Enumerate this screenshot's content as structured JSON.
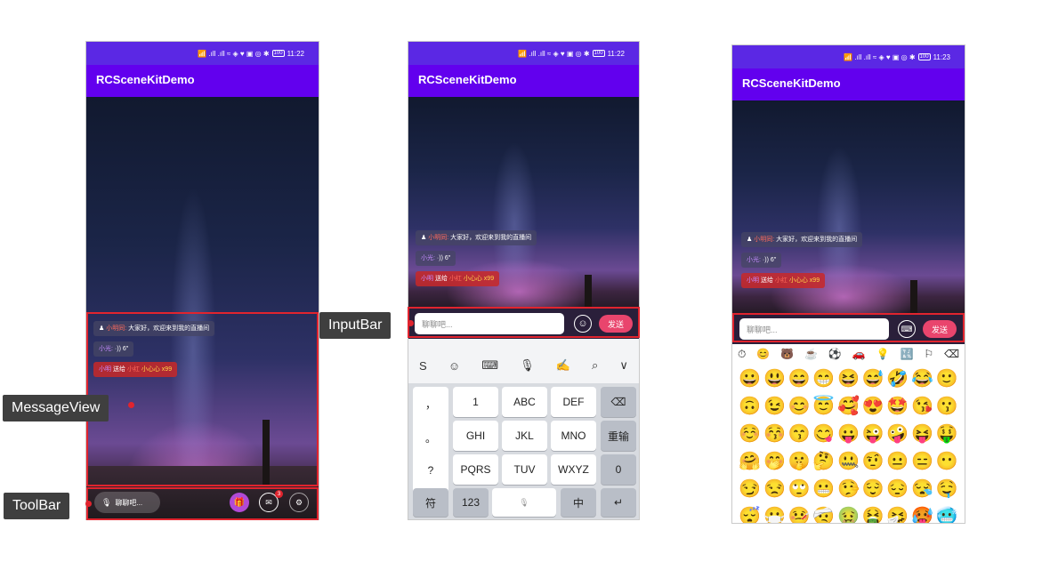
{
  "phones": [
    {
      "status": {
        "icons": "📶 .ıll .ıll ≈ ◈ ♥ ▣ ◎ ✱",
        "battery": "100",
        "time": "11:22"
      },
      "app_title": "RCSceneKitDemo"
    },
    {
      "status": {
        "icons": "📶 .ıll .ıll ≈ ◈ ♥ ▣ ◎ ✱",
        "battery": "100",
        "time": "11:22"
      },
      "app_title": "RCSceneKitDemo"
    },
    {
      "status": {
        "icons": "📶 .ıll .ıll ≈ ◈ ♥ ▣ ◎ ✱",
        "battery": "100",
        "time": "11:23"
      },
      "app_title": "RCSceneKitDemo"
    }
  ],
  "messages": {
    "m1_name": "小明同:",
    "m1_text": "大家好，欢迎来到我的直播间",
    "m2_name": "小光:",
    "m2_text": "·)) 6″",
    "m3_name": "小明",
    "m3_mid": "送给",
    "m3_target": "小红",
    "m3_gift": "小心心 x99"
  },
  "toolbar": {
    "input_placeholder": "聊聊吧...",
    "mic_icon": "🎙",
    "badge_count": "3"
  },
  "inputbar": {
    "placeholder": "聊聊吧...",
    "send_label": "发送",
    "emoji_icon": "☺",
    "keyboard_icon": "⌨"
  },
  "callouts": {
    "messageview": "MessageView",
    "toolbar": "ToolBar",
    "inputbar": "InputBar"
  },
  "keyboard": {
    "toolbar_icons": [
      "S",
      "☺",
      "⌨",
      "🎙",
      "✍",
      "⌕",
      "∨"
    ],
    "left_column": [
      "，",
      "。",
      "?",
      "!"
    ],
    "rows": [
      [
        {
          "top": "",
          "label": "1"
        },
        {
          "top": "2",
          "label": "ABC"
        },
        {
          "top": "3",
          "label": "DEF"
        }
      ],
      [
        {
          "top": "4",
          "label": "GHI"
        },
        {
          "top": "5",
          "label": "JKL"
        },
        {
          "top": "6",
          "label": "MNO"
        }
      ],
      [
        {
          "top": "7",
          "label": "PQRS"
        },
        {
          "top": "8",
          "label": "TUV"
        },
        {
          "top": "9",
          "label": "WXYZ"
        }
      ]
    ],
    "right_column": [
      "⌫",
      "重输",
      "0"
    ],
    "bottom_row": [
      "符",
      "123",
      "🎙",
      "中",
      "↵"
    ]
  },
  "emoji_panel": {
    "tabs": [
      "⏱",
      "😊",
      "🐻",
      "☕",
      "⚽",
      "🚗",
      "💡",
      "🔣",
      "⚐",
      "⌫"
    ],
    "emojis": [
      "😀",
      "😃",
      "😄",
      "😁",
      "😆",
      "😅",
      "🤣",
      "😂",
      "🙂",
      "🙃",
      "😉",
      "😊",
      "😇",
      "🥰",
      "😍",
      "🤩",
      "😘",
      "😗",
      "☺️",
      "😚",
      "😙",
      "😋",
      "😛",
      "😜",
      "🤪",
      "😝",
      "🤑",
      "🤗",
      "🤭",
      "🤫",
      "🤔",
      "🤐",
      "🤨",
      "😐",
      "😑",
      "😶",
      "😏",
      "😒",
      "🙄",
      "😬",
      "🤥",
      "😌",
      "😔",
      "😪",
      "🤤",
      "😴",
      "😷",
      "🤒",
      "🤕",
      "🤢",
      "🤮",
      "🤧",
      "🥵",
      "🥶"
    ]
  }
}
